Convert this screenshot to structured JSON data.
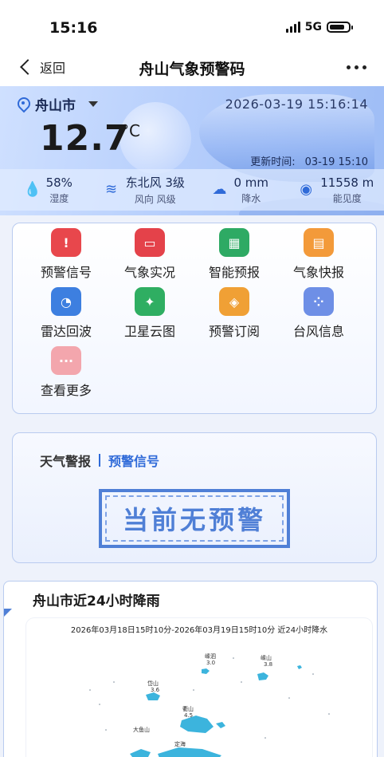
{
  "status_bar": {
    "time": "15:16",
    "network": "5G"
  },
  "nav": {
    "back_label": "返回",
    "title": "舟山气象预警码"
  },
  "weather": {
    "city": "舟山市",
    "datetime": "2026-03-19 15:16:14",
    "temperature": "12.7",
    "temp_unit": "°C",
    "update_label": "更新时间:",
    "update_time": "03-19 15:10",
    "stats": [
      {
        "icon": "humidity-icon",
        "value": "58%",
        "label": "湿度"
      },
      {
        "icon": "wind-icon",
        "value": "东北风 3级",
        "label": "风向 风级"
      },
      {
        "icon": "rain-icon",
        "value": "0 mm",
        "label": "降水"
      },
      {
        "icon": "eye-icon",
        "value": "11558 m",
        "label": "能见度"
      }
    ]
  },
  "services": [
    {
      "name": "预警信号",
      "icon": "warning-icon",
      "color": "#e8474c"
    },
    {
      "name": "气象实况",
      "icon": "monitor-icon",
      "color": "#e4424a"
    },
    {
      "name": "智能预报",
      "icon": "grid-board-icon",
      "color": "#2eaa64"
    },
    {
      "name": "气象快报",
      "icon": "report-icon",
      "color": "#f39a3a"
    },
    {
      "name": "雷达回波",
      "icon": "radar-icon",
      "color": "#3d7fe0"
    },
    {
      "name": "卫星云图",
      "icon": "satellite-icon",
      "color": "#2fae62"
    },
    {
      "name": "预警订阅",
      "icon": "subscribe-cube-icon",
      "color": "#f0a035"
    },
    {
      "name": "台风信息",
      "icon": "typhoon-node-icon",
      "color": "#6e8fe6"
    },
    {
      "name": "查看更多",
      "icon": "more-dots-icon",
      "color": "#f3a6ad"
    }
  ],
  "warning": {
    "tab_weather": "天气警报",
    "tab_signal": "预警信号",
    "stamp": "当前无预警"
  },
  "rain": {
    "title": "舟山市近24小时降雨",
    "caption": "2026年03月18日15时10分-2026年03月19日15时10分  近24小时降水",
    "map_labels": [
      {
        "name": "嵊泗",
        "value": "3.0"
      },
      {
        "name": "嵊山",
        "value": "3.8"
      },
      {
        "name": "岱山",
        "value": "3.6"
      },
      {
        "name": "衢山",
        "value": "4.5"
      },
      {
        "name": "大鱼山",
        "value": ""
      },
      {
        "name": "定海",
        "value": ""
      }
    ]
  }
}
